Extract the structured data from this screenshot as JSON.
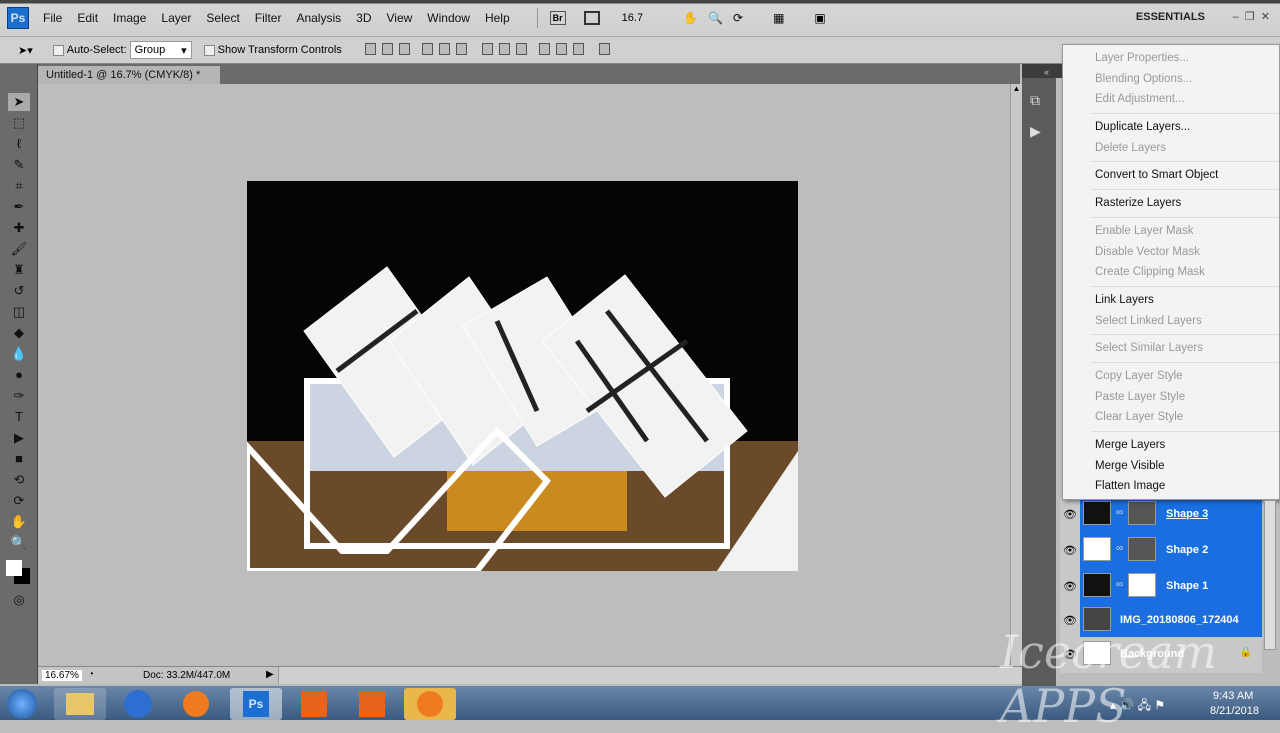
{
  "app": {
    "logo": "Ps",
    "workspace": "ESSENTIALS"
  },
  "menu": [
    "File",
    "Edit",
    "Image",
    "Layer",
    "Select",
    "Filter",
    "Analysis",
    "3D",
    "View",
    "Window",
    "Help"
  ],
  "menubar_extras": {
    "bridge": "Br",
    "zoom": "16.7"
  },
  "options": {
    "auto_select_label": "Auto-Select:",
    "auto_select_value": "Group",
    "transform_label": "Show Transform Controls"
  },
  "document": {
    "tab": "Untitled-1 @ 16.7% (CMYK/8) *",
    "close": "×"
  },
  "context_menu": [
    {
      "label": "Layer Properties...",
      "enabled": false
    },
    {
      "label": "Blending Options...",
      "enabled": false
    },
    {
      "label": "Edit Adjustment...",
      "enabled": false
    },
    {
      "sep": true
    },
    {
      "label": "Duplicate Layers...",
      "enabled": true
    },
    {
      "label": "Delete Layers",
      "enabled": false
    },
    {
      "sep": true
    },
    {
      "label": "Convert to Smart Object",
      "enabled": true
    },
    {
      "sep": true
    },
    {
      "label": "Rasterize Layers",
      "enabled": true
    },
    {
      "sep": true
    },
    {
      "label": "Enable Layer Mask",
      "enabled": false
    },
    {
      "label": "Disable Vector Mask",
      "enabled": false
    },
    {
      "label": "Create Clipping Mask",
      "enabled": false
    },
    {
      "sep": true
    },
    {
      "label": "Link Layers",
      "enabled": true
    },
    {
      "label": "Select Linked Layers",
      "enabled": false
    },
    {
      "sep": true
    },
    {
      "label": "Select Similar Layers",
      "enabled": false
    },
    {
      "sep": true
    },
    {
      "label": "Copy Layer Style",
      "enabled": false
    },
    {
      "label": "Paste Layer Style",
      "enabled": false
    },
    {
      "label": "Clear Layer Style",
      "enabled": false
    },
    {
      "sep": true
    },
    {
      "label": "Merge Layers",
      "enabled": true
    },
    {
      "label": "Merge Visible",
      "enabled": true
    },
    {
      "label": "Flatten Image",
      "enabled": true
    }
  ],
  "layers": [
    {
      "name": "Shape 3",
      "thumb": "#111",
      "mask": "#555"
    },
    {
      "name": "Shape 2",
      "thumb": "#fff",
      "mask": "#555"
    },
    {
      "name": "Shape 1",
      "thumb": "#111",
      "mask": "#fff"
    },
    {
      "name": "IMG_20180806_172404",
      "thumb": "#444"
    },
    {
      "name": "Background",
      "thumb": "#fff"
    }
  ],
  "status": {
    "zoom": "16.67%",
    "doc": "Doc: 33.2M/447.0M"
  },
  "taskbar": {
    "time": "9:43 AM",
    "date": "8/21/2018"
  },
  "watermark": "Icecream APPS",
  "colors": {
    "selection": "#1a6ee0",
    "menu_bg": "#f3f3f3"
  }
}
